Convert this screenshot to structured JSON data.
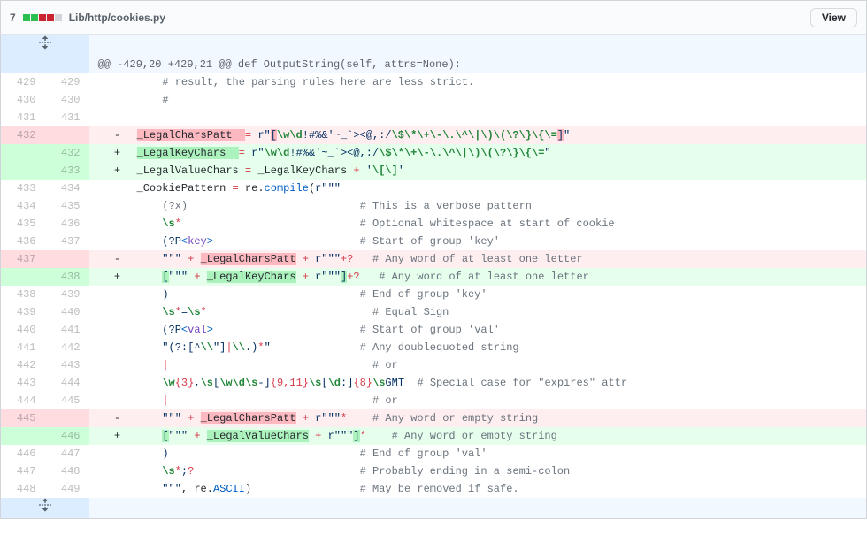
{
  "header": {
    "diffstat_count": "7",
    "additions": 4,
    "deletions": 3,
    "file_path": "Lib/http/cookies.py",
    "view_button": "View"
  },
  "hunk": {
    "text": "@@ -429,20 +429,21 @@ def OutputString(self, attrs=None):"
  },
  "lines": [
    {
      "type": "ctx",
      "old": "429",
      "new": "429",
      "segments": [
        {
          "t": "    ",
          "c": ""
        },
        {
          "t": "# result, the parsing rules here are less strict.",
          "c": "pl-c"
        }
      ]
    },
    {
      "type": "ctx",
      "old": "430",
      "new": "430",
      "segments": [
        {
          "t": "    ",
          "c": ""
        },
        {
          "t": "#",
          "c": "pl-c"
        }
      ]
    },
    {
      "type": "ctx",
      "old": "431",
      "new": "431",
      "segments": [
        {
          "t": "",
          "c": ""
        }
      ]
    },
    {
      "type": "del",
      "old": "432",
      "new": "",
      "segments": [
        {
          "t": "_LegalCharsPatt  ",
          "c": "",
          "h": "del"
        },
        {
          "t": "=",
          "c": "pl-k"
        },
        {
          "t": " ",
          "c": ""
        },
        {
          "t": "r\"",
          "c": "pl-s"
        },
        {
          "t": "[",
          "c": "pl-s",
          "h": "del"
        },
        {
          "t": "\\w\\d",
          "c": "pl-cce"
        },
        {
          "t": "!#%&'~_`><@,:/",
          "c": "pl-s"
        },
        {
          "t": "\\$\\*\\+\\-\\.\\^\\|\\)\\(\\?\\}\\{\\=",
          "c": "pl-cce"
        },
        {
          "t": "]",
          "c": "pl-s",
          "h": "del"
        },
        {
          "t": "\"",
          "c": "pl-s"
        }
      ]
    },
    {
      "type": "add",
      "old": "",
      "new": "432",
      "segments": [
        {
          "t": "_LegalKeyChars  ",
          "c": "",
          "h": "add"
        },
        {
          "t": "=",
          "c": "pl-k"
        },
        {
          "t": " ",
          "c": ""
        },
        {
          "t": "r\"",
          "c": "pl-s"
        },
        {
          "t": "\\w\\d",
          "c": "pl-cce"
        },
        {
          "t": "!#%&'~_`><@,:/",
          "c": "pl-s"
        },
        {
          "t": "\\$\\*\\+\\-\\.\\^\\|\\)\\(\\?\\}\\{\\=",
          "c": "pl-cce"
        },
        {
          "t": "\"",
          "c": "pl-s"
        }
      ]
    },
    {
      "type": "add",
      "old": "",
      "new": "433",
      "segments": [
        {
          "t": "_LegalValueChars ",
          "c": ""
        },
        {
          "t": "=",
          "c": "pl-k"
        },
        {
          "t": " _LegalKeyChars ",
          "c": ""
        },
        {
          "t": "+",
          "c": "pl-k"
        },
        {
          "t": " ",
          "c": ""
        },
        {
          "t": "'",
          "c": "pl-s"
        },
        {
          "t": "\\[\\]",
          "c": "pl-cce"
        },
        {
          "t": "'",
          "c": "pl-s"
        }
      ]
    },
    {
      "type": "ctx",
      "old": "433",
      "new": "434",
      "segments": [
        {
          "t": "_CookiePattern ",
          "c": ""
        },
        {
          "t": "=",
          "c": "pl-k"
        },
        {
          "t": " re.",
          "c": ""
        },
        {
          "t": "compile",
          "c": "pl-c1"
        },
        {
          "t": "(",
          "c": ""
        },
        {
          "t": "r\"\"\"",
          "c": "pl-s"
        }
      ]
    },
    {
      "type": "ctx",
      "old": "434",
      "new": "435",
      "segments": [
        {
          "t": "    ",
          "c": "pl-s"
        },
        {
          "t": "(?x)",
          "c": "pl-c"
        },
        {
          "t": "                           ",
          "c": "pl-s"
        },
        {
          "t": "# This is a verbose pattern",
          "c": "pl-c"
        }
      ]
    },
    {
      "type": "ctx",
      "old": "435",
      "new": "436",
      "segments": [
        {
          "t": "    ",
          "c": "pl-s"
        },
        {
          "t": "\\s",
          "c": "pl-cce"
        },
        {
          "t": "*",
          "c": "pl-k"
        },
        {
          "t": "                            ",
          "c": "pl-s"
        },
        {
          "t": "# Optional whitespace at start of cookie",
          "c": "pl-c"
        }
      ]
    },
    {
      "type": "ctx",
      "old": "436",
      "new": "437",
      "segments": [
        {
          "t": "    (?P",
          "c": "pl-s"
        },
        {
          "t": "<",
          "c": "pl-c1"
        },
        {
          "t": "key",
          "c": "pl-en"
        },
        {
          "t": ">",
          "c": "pl-c1"
        },
        {
          "t": "                       ",
          "c": "pl-s"
        },
        {
          "t": "# Start of group 'key'",
          "c": "pl-c"
        }
      ]
    },
    {
      "type": "del",
      "old": "437",
      "new": "",
      "segments": [
        {
          "t": "    \"\"\"",
          "c": "pl-s"
        },
        {
          "t": " ",
          "c": ""
        },
        {
          "t": "+",
          "c": "pl-k"
        },
        {
          "t": " ",
          "c": ""
        },
        {
          "t": "_LegalCharsPatt",
          "c": "",
          "h": "del"
        },
        {
          "t": " ",
          "c": ""
        },
        {
          "t": "+",
          "c": "pl-k"
        },
        {
          "t": " ",
          "c": ""
        },
        {
          "t": "r\"\"\"",
          "c": "pl-s"
        },
        {
          "t": "+?",
          "c": "pl-k"
        },
        {
          "t": "   ",
          "c": "pl-s"
        },
        {
          "t": "# Any word of at least one letter",
          "c": "pl-c"
        }
      ]
    },
    {
      "type": "add",
      "old": "",
      "new": "438",
      "segments": [
        {
          "t": "    ",
          "c": "pl-s"
        },
        {
          "t": "[",
          "c": "pl-s",
          "h": "add"
        },
        {
          "t": "\"\"\"",
          "c": "pl-s"
        },
        {
          "t": " ",
          "c": ""
        },
        {
          "t": "+",
          "c": "pl-k"
        },
        {
          "t": " ",
          "c": ""
        },
        {
          "t": "_LegalKeyChars",
          "c": "",
          "h": "add"
        },
        {
          "t": " ",
          "c": ""
        },
        {
          "t": "+",
          "c": "pl-k"
        },
        {
          "t": " ",
          "c": ""
        },
        {
          "t": "r\"\"\"",
          "c": "pl-s"
        },
        {
          "t": "]",
          "c": "pl-s",
          "h": "add"
        },
        {
          "t": "+?",
          "c": "pl-k"
        },
        {
          "t": "   ",
          "c": "pl-s"
        },
        {
          "t": "# Any word of at least one letter",
          "c": "pl-c"
        }
      ]
    },
    {
      "type": "ctx",
      "old": "438",
      "new": "439",
      "segments": [
        {
          "t": "    ",
          "c": "pl-s"
        },
        {
          "t": ")",
          "c": "pl-s"
        },
        {
          "t": "                              ",
          "c": "pl-s"
        },
        {
          "t": "# End of group 'key'",
          "c": "pl-c"
        }
      ]
    },
    {
      "type": "ctx",
      "old": "439",
      "new": "440",
      "segments": [
        {
          "t": "    ",
          "c": "pl-s"
        },
        {
          "t": "\\s",
          "c": "pl-cce"
        },
        {
          "t": "*",
          "c": "pl-k"
        },
        {
          "t": "=",
          "c": "pl-s"
        },
        {
          "t": "\\s",
          "c": "pl-cce"
        },
        {
          "t": "*",
          "c": "pl-k"
        },
        {
          "t": "                          ",
          "c": "pl-s"
        },
        {
          "t": "# Equal Sign",
          "c": "pl-c"
        }
      ]
    },
    {
      "type": "ctx",
      "old": "440",
      "new": "441",
      "segments": [
        {
          "t": "    (?P",
          "c": "pl-s"
        },
        {
          "t": "<",
          "c": "pl-c1"
        },
        {
          "t": "val",
          "c": "pl-en"
        },
        {
          "t": ">",
          "c": "pl-c1"
        },
        {
          "t": "                       ",
          "c": "pl-s"
        },
        {
          "t": "# Start of group 'val'",
          "c": "pl-c"
        }
      ]
    },
    {
      "type": "ctx",
      "old": "441",
      "new": "442",
      "segments": [
        {
          "t": "    \"",
          "c": "pl-s"
        },
        {
          "t": "(?:",
          "c": "pl-s"
        },
        {
          "t": "[^",
          "c": "pl-s"
        },
        {
          "t": "\\\\",
          "c": "pl-cce"
        },
        {
          "t": "\"]",
          "c": "pl-s"
        },
        {
          "t": "|",
          "c": "pl-k"
        },
        {
          "t": "\\\\",
          "c": "pl-cce"
        },
        {
          "t": ".",
          "c": "pl-s"
        },
        {
          "t": ")",
          "c": "pl-s"
        },
        {
          "t": "*",
          "c": "pl-k"
        },
        {
          "t": "\"",
          "c": "pl-s"
        },
        {
          "t": "              ",
          "c": "pl-s"
        },
        {
          "t": "# Any doublequoted string",
          "c": "pl-c"
        }
      ]
    },
    {
      "type": "ctx",
      "old": "442",
      "new": "443",
      "segments": [
        {
          "t": "    ",
          "c": "pl-s"
        },
        {
          "t": "|",
          "c": "pl-k"
        },
        {
          "t": "                                ",
          "c": "pl-s"
        },
        {
          "t": "# or",
          "c": "pl-c"
        }
      ]
    },
    {
      "type": "ctx",
      "old": "443",
      "new": "444",
      "segments": [
        {
          "t": "    ",
          "c": "pl-s"
        },
        {
          "t": "\\w",
          "c": "pl-cce"
        },
        {
          "t": "{3}",
          "c": "pl-k"
        },
        {
          "t": ",",
          "c": "pl-s"
        },
        {
          "t": "\\s",
          "c": "pl-cce"
        },
        {
          "t": "[",
          "c": "pl-s"
        },
        {
          "t": "\\w\\d\\s",
          "c": "pl-cce"
        },
        {
          "t": "-]",
          "c": "pl-s"
        },
        {
          "t": "{9,11}",
          "c": "pl-k"
        },
        {
          "t": "\\s",
          "c": "pl-cce"
        },
        {
          "t": "[",
          "c": "pl-s"
        },
        {
          "t": "\\d",
          "c": "pl-cce"
        },
        {
          "t": ":]",
          "c": "pl-s"
        },
        {
          "t": "{8}",
          "c": "pl-k"
        },
        {
          "t": "\\s",
          "c": "pl-cce"
        },
        {
          "t": "GMT",
          "c": "pl-s"
        },
        {
          "t": "  ",
          "c": "pl-s"
        },
        {
          "t": "# Special case for \"expires\" attr",
          "c": "pl-c"
        }
      ]
    },
    {
      "type": "ctx",
      "old": "444",
      "new": "445",
      "segments": [
        {
          "t": "    ",
          "c": "pl-s"
        },
        {
          "t": "|",
          "c": "pl-k"
        },
        {
          "t": "                                ",
          "c": "pl-s"
        },
        {
          "t": "# or",
          "c": "pl-c"
        }
      ]
    },
    {
      "type": "del",
      "old": "445",
      "new": "",
      "segments": [
        {
          "t": "    \"\"\"",
          "c": "pl-s"
        },
        {
          "t": " ",
          "c": ""
        },
        {
          "t": "+",
          "c": "pl-k"
        },
        {
          "t": " ",
          "c": ""
        },
        {
          "t": "_LegalCharsPatt",
          "c": "",
          "h": "del"
        },
        {
          "t": " ",
          "c": ""
        },
        {
          "t": "+",
          "c": "pl-k"
        },
        {
          "t": " ",
          "c": ""
        },
        {
          "t": "r\"\"\"",
          "c": "pl-s"
        },
        {
          "t": "*",
          "c": "pl-k"
        },
        {
          "t": "    ",
          "c": "pl-s"
        },
        {
          "t": "# Any word or empty string",
          "c": "pl-c"
        }
      ]
    },
    {
      "type": "add",
      "old": "",
      "new": "446",
      "segments": [
        {
          "t": "    ",
          "c": "pl-s"
        },
        {
          "t": "[",
          "c": "pl-s",
          "h": "add"
        },
        {
          "t": "\"\"\"",
          "c": "pl-s"
        },
        {
          "t": " ",
          "c": ""
        },
        {
          "t": "+",
          "c": "pl-k"
        },
        {
          "t": " ",
          "c": ""
        },
        {
          "t": "_LegalValueChars",
          "c": "",
          "h": "add"
        },
        {
          "t": " ",
          "c": ""
        },
        {
          "t": "+",
          "c": "pl-k"
        },
        {
          "t": " ",
          "c": ""
        },
        {
          "t": "r\"\"\"",
          "c": "pl-s"
        },
        {
          "t": "]",
          "c": "pl-s",
          "h": "add"
        },
        {
          "t": "*",
          "c": "pl-k"
        },
        {
          "t": "    ",
          "c": "pl-s"
        },
        {
          "t": "# Any word or empty string",
          "c": "pl-c"
        }
      ]
    },
    {
      "type": "ctx",
      "old": "446",
      "new": "447",
      "segments": [
        {
          "t": "    ",
          "c": "pl-s"
        },
        {
          "t": ")",
          "c": "pl-s"
        },
        {
          "t": "                              ",
          "c": "pl-s"
        },
        {
          "t": "# End of group 'val'",
          "c": "pl-c"
        }
      ]
    },
    {
      "type": "ctx",
      "old": "447",
      "new": "448",
      "segments": [
        {
          "t": "    ",
          "c": "pl-s"
        },
        {
          "t": "\\s",
          "c": "pl-cce"
        },
        {
          "t": "*",
          "c": "pl-k"
        },
        {
          "t": ";",
          "c": "pl-s"
        },
        {
          "t": "?",
          "c": "pl-k"
        },
        {
          "t": "                          ",
          "c": "pl-s"
        },
        {
          "t": "# Probably ending in a semi-colon",
          "c": "pl-c"
        }
      ]
    },
    {
      "type": "ctx",
      "old": "448",
      "new": "449",
      "segments": [
        {
          "t": "    \"\"\"",
          "c": "pl-s"
        },
        {
          "t": ", re.",
          "c": ""
        },
        {
          "t": "ASCII",
          "c": "pl-c1"
        },
        {
          "t": ")                 ",
          "c": ""
        },
        {
          "t": "# May be removed if safe.",
          "c": "pl-c"
        }
      ]
    }
  ]
}
